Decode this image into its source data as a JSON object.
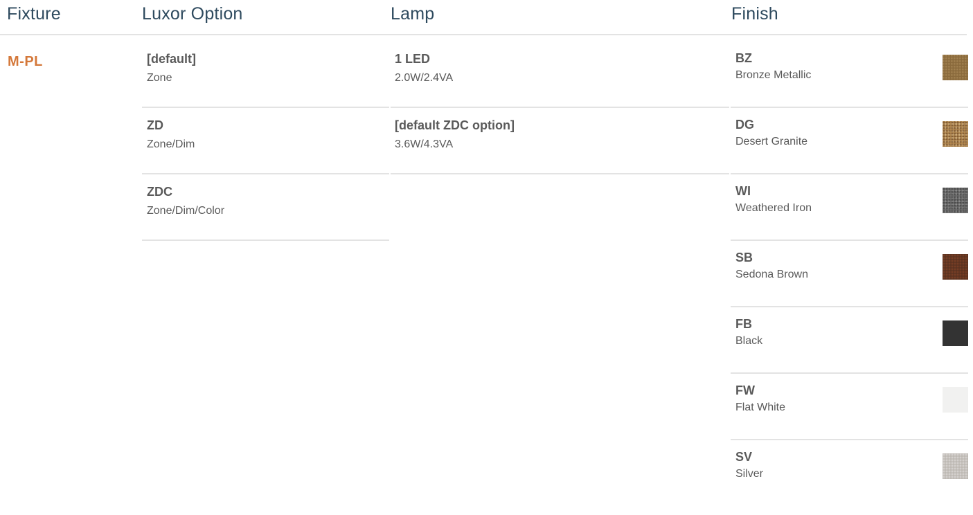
{
  "header": {
    "fixture": "Fixture",
    "option": "Luxor Option",
    "lamp": "Lamp",
    "finish": "Finish"
  },
  "fixture": {
    "code": "M-PL"
  },
  "options": [
    {
      "code": "[default]",
      "desc": "Zone"
    },
    {
      "code": "ZD",
      "desc": "Zone/Dim"
    },
    {
      "code": "ZDC",
      "desc": "Zone/Dim/Color"
    }
  ],
  "lamps": [
    {
      "code": "1 LED",
      "desc": "2.0W/2.4VA"
    },
    {
      "code": "[default ZDC option]",
      "desc": "3.6W/4.3VA"
    }
  ],
  "finishes": [
    {
      "code": "BZ",
      "desc": "Bronze Metallic",
      "swatch": "bronze-metallic-swatch",
      "color": "#8a6a3c"
    },
    {
      "code": "DG",
      "desc": "Desert Granite",
      "swatch": "desert-granite-swatch",
      "color": "#b48a52"
    },
    {
      "code": "WI",
      "desc": "Weathered Iron",
      "swatch": "weathered-iron-swatch",
      "color": "#6e6e6e"
    },
    {
      "code": "SB",
      "desc": "Sedona Brown",
      "swatch": "sedona-brown-swatch",
      "color": "#5a3220"
    },
    {
      "code": "FB",
      "desc": "Black",
      "swatch": "black-swatch",
      "color": "#333333"
    },
    {
      "code": "FW",
      "desc": "Flat White",
      "swatch": "flat-white-swatch",
      "color": "#f1f1f0"
    },
    {
      "code": "SV",
      "desc": "Silver",
      "swatch": "silver-swatch",
      "color": "#bdb8b3"
    }
  ],
  "colors": {
    "heading": "#2e4a5e",
    "accent": "#d4783a",
    "text": "#5a5a5a",
    "rule": "#e3e3e3"
  }
}
